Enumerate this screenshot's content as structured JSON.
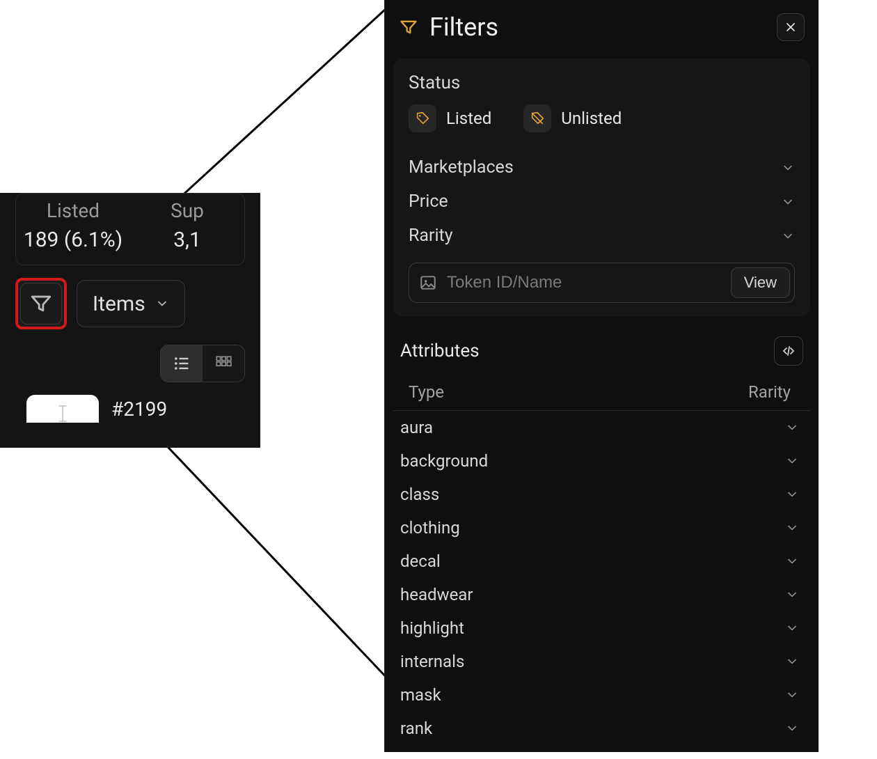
{
  "small": {
    "stats": [
      {
        "label": "Listed",
        "value": "189 (6.1%)"
      },
      {
        "label": "Sup",
        "value": "3,1"
      }
    ],
    "items_dropdown": "Items",
    "first_item_id": "#2199"
  },
  "filters": {
    "title": "Filters",
    "status": {
      "label": "Status",
      "options": [
        {
          "key": "listed",
          "label": "Listed"
        },
        {
          "key": "unlisted",
          "label": "Unlisted"
        }
      ]
    },
    "sections": [
      {
        "label": "Marketplaces"
      },
      {
        "label": "Price"
      },
      {
        "label": "Rarity"
      }
    ],
    "token_input_placeholder": "Token ID/Name",
    "view_button": "View",
    "attributes": {
      "title": "Attributes",
      "columns": {
        "type": "Type",
        "rarity": "Rarity"
      },
      "rows": [
        "aura",
        "background",
        "class",
        "clothing",
        "decal",
        "headwear",
        "highlight",
        "internals",
        "mask",
        "rank"
      ]
    }
  }
}
